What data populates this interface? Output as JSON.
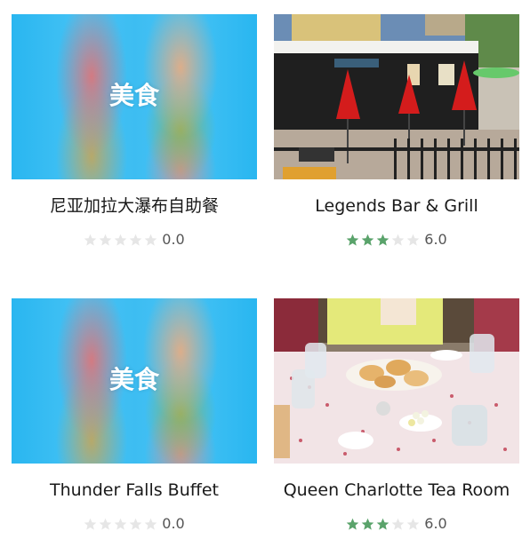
{
  "colors": {
    "star_filled": "#5aa36b",
    "star_empty": "#e6e6e6"
  },
  "restaurants": [
    {
      "title": "尼亚加拉大瀑布自助餐",
      "score": "0.0",
      "stars": 0,
      "image": "placeholder",
      "placeholder_text": "美食"
    },
    {
      "title": "Legends Bar & Grill",
      "score": "6.0",
      "stars": 3,
      "image": "photo-patio"
    },
    {
      "title": "Thunder Falls Buffet",
      "score": "0.0",
      "stars": 0,
      "image": "placeholder",
      "placeholder_text": "美食"
    },
    {
      "title": "Queen Charlotte Tea Room",
      "score": "6.0",
      "stars": 3,
      "image": "photo-tea"
    }
  ]
}
